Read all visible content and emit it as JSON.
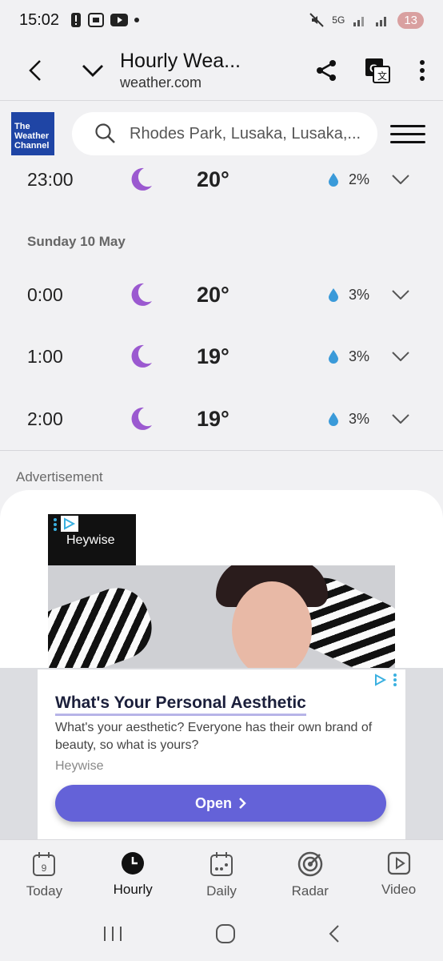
{
  "status_bar": {
    "time": "15:02",
    "battery": "13",
    "network": "5G"
  },
  "browser": {
    "title": "Hourly Wea...",
    "domain": "weather.com"
  },
  "header": {
    "logo_lines": [
      "The",
      "Weather",
      "Channel"
    ],
    "search_text": "Rhodes Park, Lusaka, Lusaka,..."
  },
  "hourly": {
    "top_row": {
      "time": "23:00",
      "temp": "20°",
      "precip": "2%",
      "icon": "moon-icon"
    },
    "day_label": "Sunday 10 May",
    "rows": [
      {
        "time": "0:00",
        "temp": "20°",
        "precip": "3%",
        "icon": "moon-icon"
      },
      {
        "time": "1:00",
        "temp": "19°",
        "precip": "3%",
        "icon": "moon-icon"
      },
      {
        "time": "2:00",
        "temp": "19°",
        "precip": "3%",
        "icon": "moon-icon"
      }
    ]
  },
  "ad": {
    "label": "Advertisement",
    "brand": "Heywise",
    "title": "What's Your Personal Aesthetic",
    "description": "What's your aesthetic? Everyone has their own brand of beauty, so what is yours?",
    "advertiser": "Heywise",
    "cta": "Open"
  },
  "bottom_nav": {
    "items": [
      {
        "label": "Today",
        "icon": "calendar-icon",
        "badge": "9"
      },
      {
        "label": "Hourly",
        "icon": "clock-icon",
        "active": true
      },
      {
        "label": "Daily",
        "icon": "calendar-dots-icon"
      },
      {
        "label": "Radar",
        "icon": "radar-icon"
      },
      {
        "label": "Video",
        "icon": "video-icon"
      }
    ]
  },
  "colors": {
    "accent": "#6462d8",
    "moon": "#9b59d0",
    "drop": "#3a9ad9",
    "logo_bg": "#1f45a5"
  }
}
